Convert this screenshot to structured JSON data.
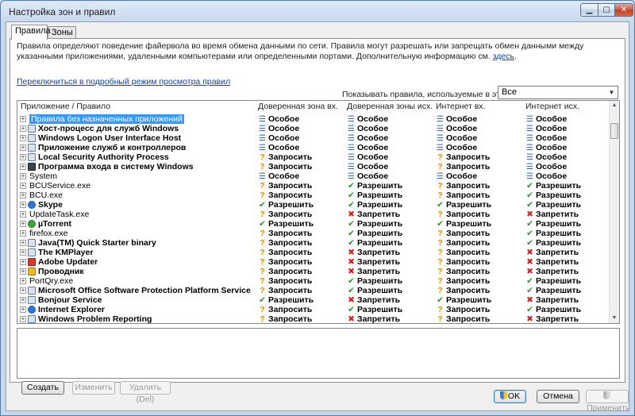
{
  "window": {
    "title": "Настройка зон и правил",
    "min_glyph": "▁",
    "max_glyph": "▢",
    "close_glyph": "✕"
  },
  "tabs": [
    {
      "label": "Правила",
      "active": true
    },
    {
      "label": "Зоны",
      "active": false
    }
  ],
  "description": {
    "text": "Правила определяют поведение файервола во время обмена данными по сети. Правила могут разрешать или запрещать обмен данными между указанными приложениями, удаленными компьютерами или определенными портами. Дополнительную информацию см. ",
    "link": "здесь",
    "end": "."
  },
  "switch_link": "Переключиться в подробный режим просмотра правил",
  "profile": {
    "label": "Показывать правила, используемые в этом профиле:",
    "selected": "Все"
  },
  "columns": [
    "Приложение / Правило",
    "Доверенная зона вх.",
    "Доверенная зоны исх.",
    "Интернет вх.",
    "Интернет исх."
  ],
  "symbols": {
    "special": "☰",
    "ask": "?",
    "allow": "✔",
    "deny": "✖"
  },
  "rules": [
    {
      "name": "Правила без назначенных приложений",
      "icon": "none",
      "selected": true,
      "cells": [
        [
          "special",
          "Особое"
        ],
        [
          "special",
          "Особое"
        ],
        [
          "special",
          "Особое"
        ],
        [
          "special",
          "Особое"
        ]
      ]
    },
    {
      "name": "Хост-процесс для служб Windows",
      "icon": "default",
      "cells": [
        [
          "special",
          "Особое"
        ],
        [
          "special",
          "Особое"
        ],
        [
          "special",
          "Особое"
        ],
        [
          "special",
          "Особое"
        ]
      ]
    },
    {
      "name": "Windows Logon User Interface Host",
      "icon": "default",
      "cells": [
        [
          "special",
          "Особое"
        ],
        [
          "special",
          "Особое"
        ],
        [
          "special",
          "Особое"
        ],
        [
          "special",
          "Особое"
        ]
      ]
    },
    {
      "name": "Приложение служб и контроллеров",
      "icon": "default",
      "cells": [
        [
          "special",
          "Особое"
        ],
        [
          "special",
          "Особое"
        ],
        [
          "special",
          "Особое"
        ],
        [
          "special",
          "Особое"
        ]
      ]
    },
    {
      "name": "Local Security Authority Process",
      "icon": "default",
      "cells": [
        [
          "ask",
          "Запросить"
        ],
        [
          "special",
          "Особое"
        ],
        [
          "ask",
          "Запросить"
        ],
        [
          "special",
          "Особое"
        ]
      ]
    },
    {
      "name": "Программа входа в систему Windows",
      "icon": "dark",
      "cells": [
        [
          "ask",
          "Запросить"
        ],
        [
          "special",
          "Особое"
        ],
        [
          "ask",
          "Запросить"
        ],
        [
          "special",
          "Особое"
        ]
      ]
    },
    {
      "name": "System",
      "icon": "none",
      "cells": [
        [
          "special",
          "Особое"
        ],
        [
          "special",
          "Особое"
        ],
        [
          "special",
          "Особое"
        ],
        [
          "special",
          "Особое"
        ]
      ]
    },
    {
      "name": "BCUService.exe",
      "icon": "none",
      "cells": [
        [
          "ask",
          "Запросить"
        ],
        [
          "allow",
          "Разрешить"
        ],
        [
          "ask",
          "Запросить"
        ],
        [
          "allow",
          "Разрешить"
        ]
      ]
    },
    {
      "name": "BCU.exe",
      "icon": "none",
      "cells": [
        [
          "ask",
          "Запросить"
        ],
        [
          "allow",
          "Разрешить"
        ],
        [
          "ask",
          "Запросить"
        ],
        [
          "allow",
          "Разрешить"
        ]
      ]
    },
    {
      "name": "Skype",
      "icon": "blue",
      "cells": [
        [
          "allow",
          "Разрешить"
        ],
        [
          "allow",
          "Разрешить"
        ],
        [
          "allow",
          "Разрешить"
        ],
        [
          "allow",
          "Разрешить"
        ]
      ]
    },
    {
      "name": "UpdateTask.exe",
      "icon": "none",
      "cells": [
        [
          "ask",
          "Запросить"
        ],
        [
          "deny",
          "Запретить"
        ],
        [
          "ask",
          "Запросить"
        ],
        [
          "deny",
          "Запретить"
        ]
      ]
    },
    {
      "name": "µTorrent",
      "icon": "green",
      "cells": [
        [
          "allow",
          "Разрешить"
        ],
        [
          "allow",
          "Разрешить"
        ],
        [
          "allow",
          "Разрешить"
        ],
        [
          "allow",
          "Разрешить"
        ]
      ]
    },
    {
      "name": "firefox.exe",
      "icon": "none",
      "cells": [
        [
          "ask",
          "Запросить"
        ],
        [
          "allow",
          "Разрешить"
        ],
        [
          "ask",
          "Запросить"
        ],
        [
          "allow",
          "Разрешить"
        ]
      ]
    },
    {
      "name": "Java(TM) Quick Starter binary",
      "icon": "default",
      "cells": [
        [
          "ask",
          "Запросить"
        ],
        [
          "allow",
          "Разрешить"
        ],
        [
          "ask",
          "Запросить"
        ],
        [
          "allow",
          "Разрешить"
        ]
      ]
    },
    {
      "name": "The KMPlayer",
      "icon": "default",
      "cells": [
        [
          "ask",
          "Запросить"
        ],
        [
          "deny",
          "Запретить"
        ],
        [
          "ask",
          "Запросить"
        ],
        [
          "deny",
          "Запретить"
        ]
      ]
    },
    {
      "name": "Adobe Updater",
      "icon": "red",
      "cells": [
        [
          "ask",
          "Запросить"
        ],
        [
          "deny",
          "Запретить"
        ],
        [
          "ask",
          "Запросить"
        ],
        [
          "deny",
          "Запретить"
        ]
      ]
    },
    {
      "name": "Проводник",
      "icon": "gold",
      "cells": [
        [
          "ask",
          "Запросить"
        ],
        [
          "deny",
          "Запретить"
        ],
        [
          "ask",
          "Запросить"
        ],
        [
          "deny",
          "Запретить"
        ]
      ]
    },
    {
      "name": "PortQry.exe",
      "icon": "none",
      "cells": [
        [
          "ask",
          "Запросить"
        ],
        [
          "allow",
          "Разрешить"
        ],
        [
          "ask",
          "Запросить"
        ],
        [
          "allow",
          "Разрешить"
        ]
      ]
    },
    {
      "name": "Microsoft Office Software Protection Platform Service",
      "icon": "default",
      "cells": [
        [
          "ask",
          "Запросить"
        ],
        [
          "allow",
          "Разрешить"
        ],
        [
          "ask",
          "Запросить"
        ],
        [
          "allow",
          "Разрешить"
        ]
      ]
    },
    {
      "name": "Bonjour Service",
      "icon": "default",
      "cells": [
        [
          "allow",
          "Разрешить"
        ],
        [
          "deny",
          "Запретить"
        ],
        [
          "allow",
          "Разрешить"
        ],
        [
          "deny",
          "Запретить"
        ]
      ]
    },
    {
      "name": "Internet Explorer",
      "icon": "blue",
      "cells": [
        [
          "ask",
          "Запросить"
        ],
        [
          "allow",
          "Разрешить"
        ],
        [
          "ask",
          "Запросить"
        ],
        [
          "allow",
          "Разрешить"
        ]
      ]
    },
    {
      "name": "Windows Problem Reporting",
      "icon": "default",
      "cells": [
        [
          "ask",
          "Запросить"
        ],
        [
          "deny",
          "Запретить"
        ],
        [
          "ask",
          "Запросить"
        ],
        [
          "deny",
          "Запретить"
        ]
      ]
    }
  ],
  "buttons": {
    "create": "Создать",
    "edit": "Изменить",
    "delete": "Удалить (Del)",
    "ok": "OK",
    "cancel": "Отмена",
    "apply": "Применить"
  }
}
